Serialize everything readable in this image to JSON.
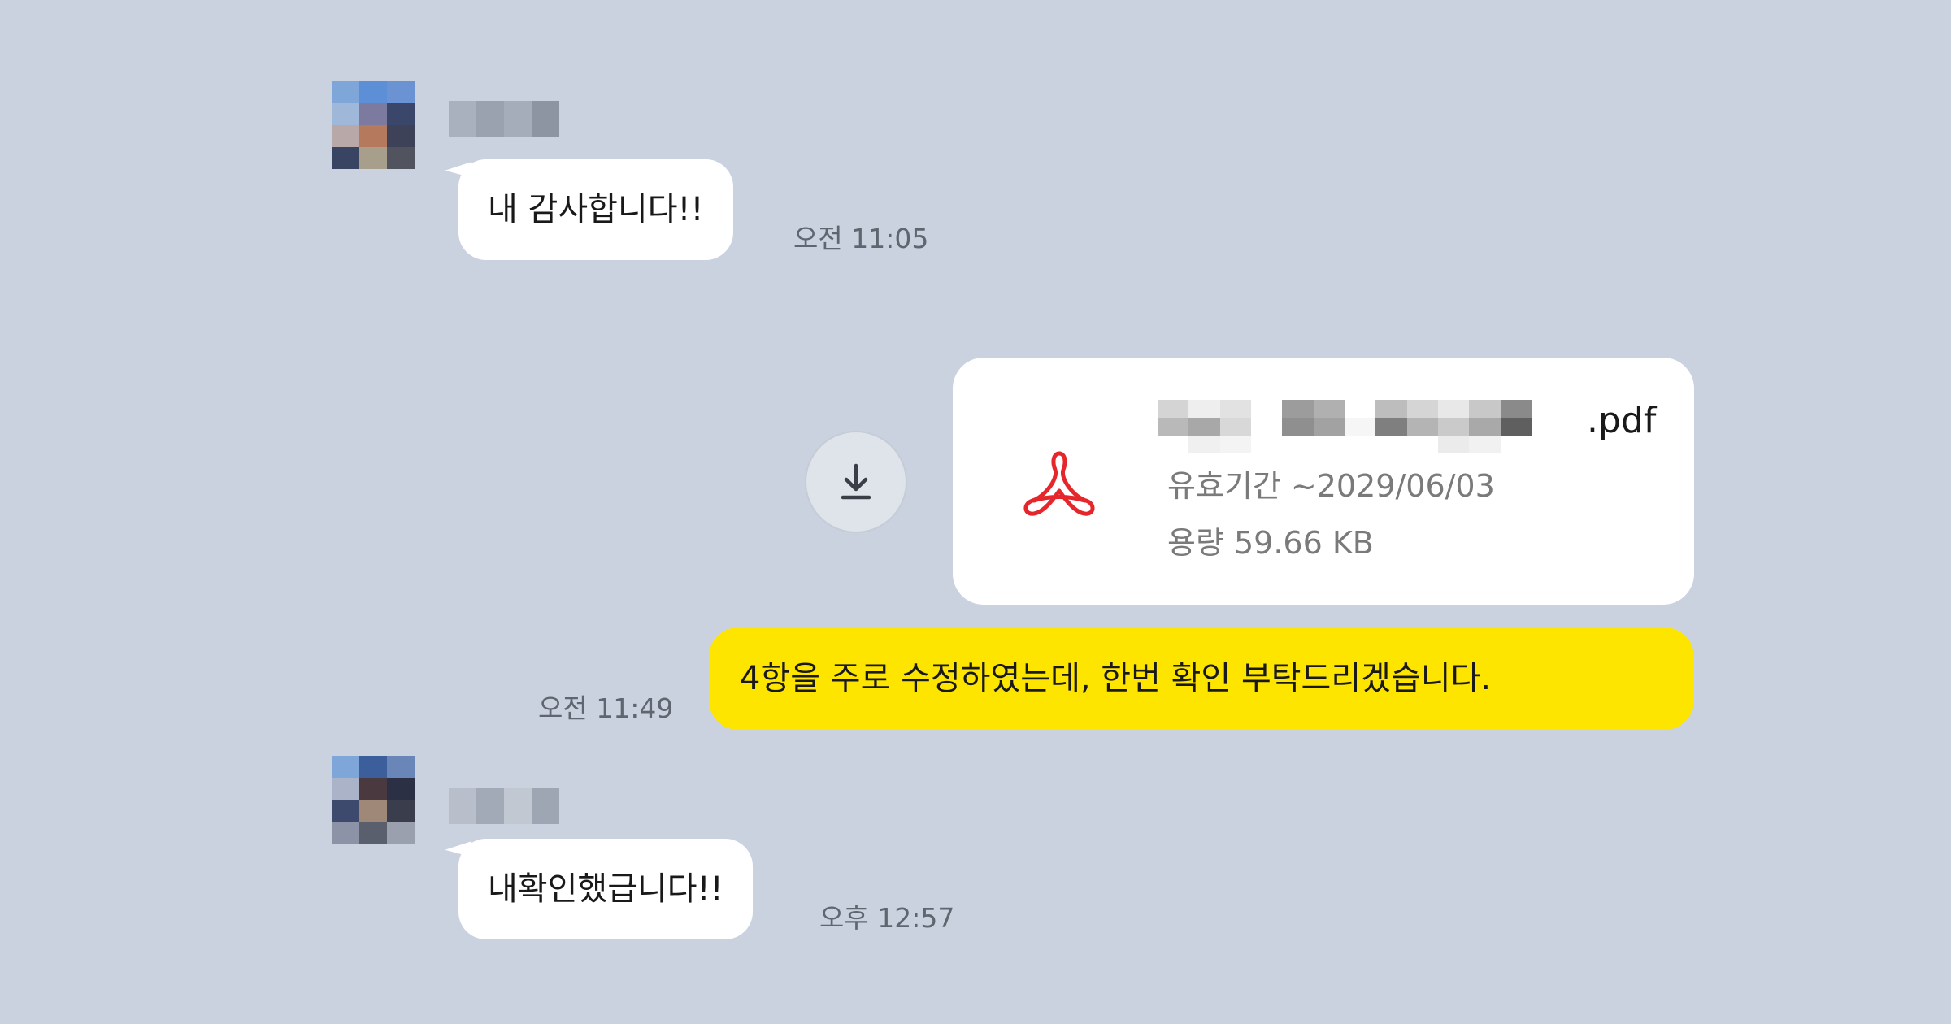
{
  "messages": [
    {
      "direction": "incoming",
      "text": "내 감사합니다!!",
      "time": "오전 11:05"
    },
    {
      "direction": "outgoing",
      "type": "file",
      "file": {
        "extension": ".pdf",
        "expiry": "유효기간 ~2029/06/03",
        "size": "용량 59.66 KB"
      }
    },
    {
      "direction": "outgoing",
      "text": "4항을 주로 수정하였는데, 한번 확인 부탁드리겠습니다.",
      "time": "오전 11:49"
    },
    {
      "direction": "incoming",
      "text": "내확인했급니다!!",
      "time": "오후 12:57"
    }
  ],
  "icons": {
    "avatar": "avatar-icon",
    "pdf": "pdf-icon",
    "download": "download-icon"
  },
  "colors": {
    "background": "#cad2e0",
    "outgoing_bubble": "#fee500",
    "incoming_bubble": "#ffffff",
    "pdf_icon": "#e5272c"
  }
}
